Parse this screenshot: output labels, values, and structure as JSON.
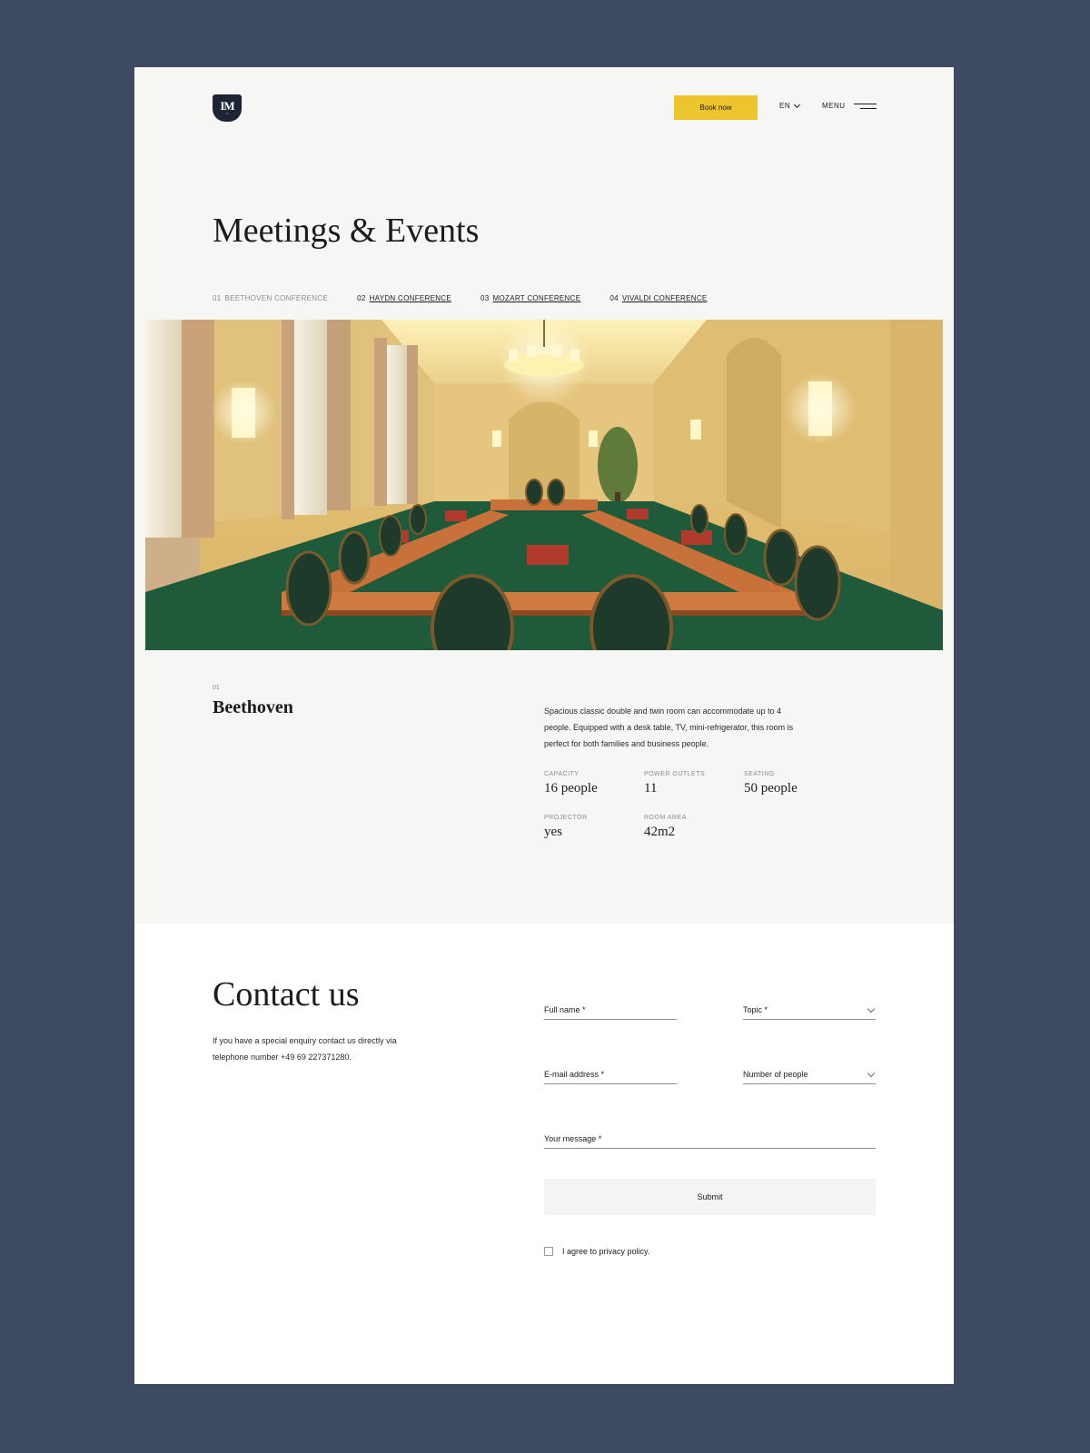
{
  "header": {
    "logo_mark": "IM",
    "book_label": "Book now",
    "lang_label": "EN",
    "menu_label": "MENU"
  },
  "page_title": "Meetings & Events",
  "tabs": [
    {
      "num": "01",
      "label": "BEETHOVEN CONFERENCE",
      "active": true
    },
    {
      "num": "02",
      "label": "HAYDN CONFERENCE",
      "active": false
    },
    {
      "num": "03",
      "label": "MOZART CONFERENCE",
      "active": false
    },
    {
      "num": "04",
      "label": "VIVALDI CONFERENCE",
      "active": false
    }
  ],
  "room": {
    "num": "01",
    "name": "Beethoven",
    "description": "Spacious classic double and twin room can accommodate up to 4 people. Equipped with a desk table, TV, mini-refrigerator, this room is perfect for both families and business people.",
    "specs": [
      {
        "key": "CAPACITY",
        "value": "16 people"
      },
      {
        "key": "POWER OUTLETS",
        "value": "11"
      },
      {
        "key": "SEATING",
        "value": "50 people"
      },
      {
        "key": "PROJECTOR",
        "value": "yes"
      },
      {
        "key": "ROOM AREA",
        "value": "42m2"
      }
    ]
  },
  "contact": {
    "title": "Contact us",
    "text": "If you have a special enquiry contact us directly via telephone number +49 69 227371280.",
    "full_name_placeholder": "Full name *",
    "topic_label": "Topic *",
    "email_placeholder": "E-mail address *",
    "people_label": "Number of people",
    "message_placeholder": "Your message *",
    "submit_label": "Submit",
    "agree_label": "I agree to privacy policy."
  },
  "colors": {
    "backdrop": "#3e4a61",
    "page": "#f6f6f4",
    "accent": "#ecc42d",
    "logo": "#1d2535"
  }
}
